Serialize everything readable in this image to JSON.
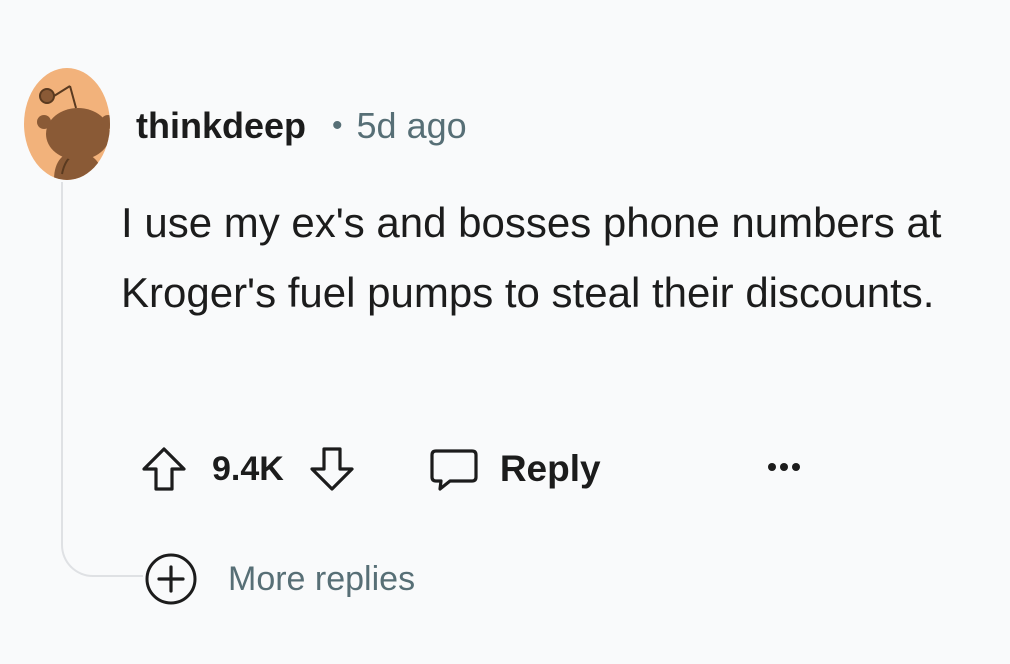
{
  "comment": {
    "author": "thinkdeep",
    "separator": "•",
    "timestamp": "5d ago",
    "body": "I use my ex's and bosses phone numbers at Kroger's fuel pumps to steal their discounts.",
    "avatar_icon": "snoo-avatar-icon"
  },
  "actions": {
    "upvote_icon": "arrow-up-icon",
    "vote_count": "9.4K",
    "downvote_icon": "arrow-down-icon",
    "reply_icon": "speech-bubble-icon",
    "reply_label": "Reply",
    "more_icon": "ellipsis-icon"
  },
  "thread": {
    "more_replies_icon": "plus-circle-icon",
    "more_replies_label": "More replies"
  },
  "colors": {
    "background": "#f9fafb",
    "text": "#1c1c1c",
    "muted": "#576f76",
    "thread_line": "#dfe1e4",
    "avatar_bg": "#f2b27b",
    "avatar_figure": "#8a5a36"
  }
}
